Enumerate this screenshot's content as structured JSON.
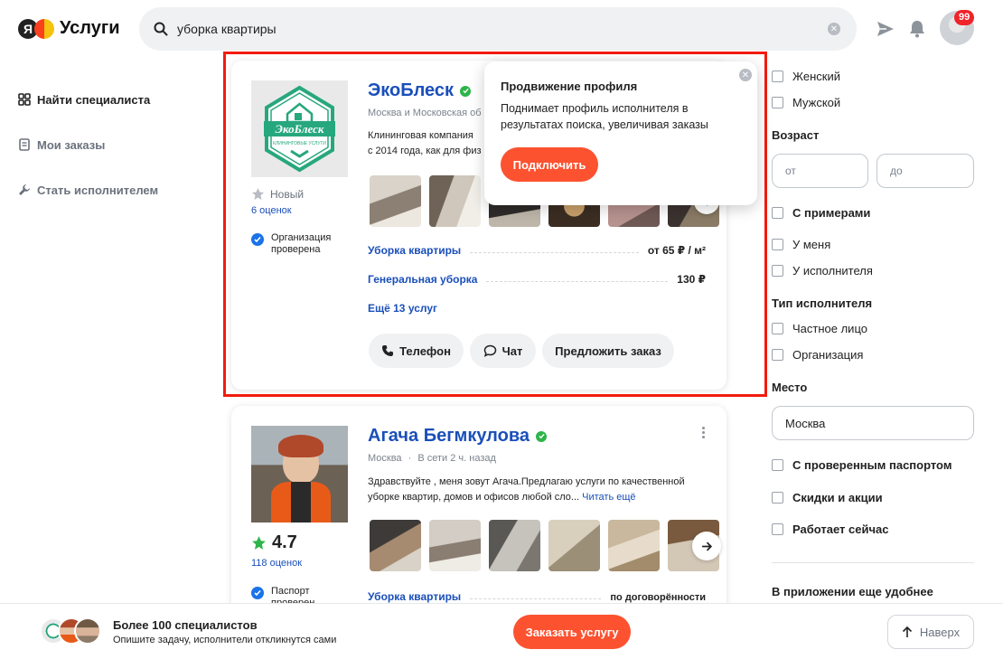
{
  "header": {
    "logo_letter": "Я",
    "logo_text": "Услуги",
    "search_value": "уборка квартиры",
    "notifications_count": "99"
  },
  "sidenav": {
    "items": [
      {
        "label": "Найти специалиста",
        "icon": "grid-icon"
      },
      {
        "label": "Мои заказы",
        "icon": "orders-icon"
      },
      {
        "label": "Стать исполнителем",
        "icon": "wrench-icon"
      }
    ]
  },
  "listing1": {
    "name": "ЭкоБлеск",
    "logo_title": "ЭкоБлеск",
    "logo_sub": "КЛИНИНГОВЫЕ УСЛУГИ",
    "location": "Москва и Московская об",
    "description_line1": "Клининговая компания",
    "description_line2": "с 2014 года, как для физ",
    "rating_label": "Новый",
    "reviews": "6 оценок",
    "verified_text_1": "Организация",
    "verified_text_2": "проверена",
    "services": [
      {
        "name": "Уборка квартиры",
        "price": "от 65 ₽ / м²"
      },
      {
        "name": "Генеральная уборка",
        "price": "130 ₽"
      }
    ],
    "more_services": "Ещё 13 услуг",
    "buttons": {
      "phone": "Телефон",
      "chat": "Чат",
      "offer": "Предложить заказ"
    }
  },
  "popover": {
    "title": "Продвижение профиля",
    "text": "Поднимает профиль исполнителя в результатах поиска, увеличивая заказы",
    "button": "Подключить"
  },
  "listing2": {
    "name": "Агача Бегмкулова",
    "location": "Москва",
    "online": "В сети 2 ч. назад",
    "description_line1": "Здравствуйте , меня зовут Агача.Предлагаю услуги по качественной",
    "description_line2": "уборке квартир, домов и офисов любой сло...",
    "read_more": "Читать ещё",
    "rating": "4.7",
    "reviews": "118 оценок",
    "verified_text_1": "Паспорт",
    "verified_text_2": "проверен",
    "service_name": "Уборка квартиры",
    "service_price": "по договорённости"
  },
  "filters": {
    "gender": [
      "Женский",
      "Мужской"
    ],
    "age_title": "Возраст",
    "age_from": "от",
    "age_to": "до",
    "with_examples": "С примерами",
    "place_options": [
      "У меня",
      "У исполнителя"
    ],
    "type_title": "Тип исполнителя",
    "type_options": [
      "Частное лицо",
      "Организация"
    ],
    "place_title": "Место",
    "place_value": "Москва",
    "passport": "С проверенным паспортом",
    "discounts": "Скидки и акции",
    "working_now": "Работает сейчас",
    "app_promo": "В приложении еще удобнее"
  },
  "bottombar": {
    "title": "Более 100 специалистов",
    "subtitle": "Опишите задачу, исполнители откликнутся сами",
    "order_button": "Заказать услугу",
    "up_button": "Наверх"
  },
  "colors": {
    "accent": "#fc5230",
    "link": "#1a4fba",
    "highlight": "#f21b0e",
    "verified": "#2db44a"
  }
}
